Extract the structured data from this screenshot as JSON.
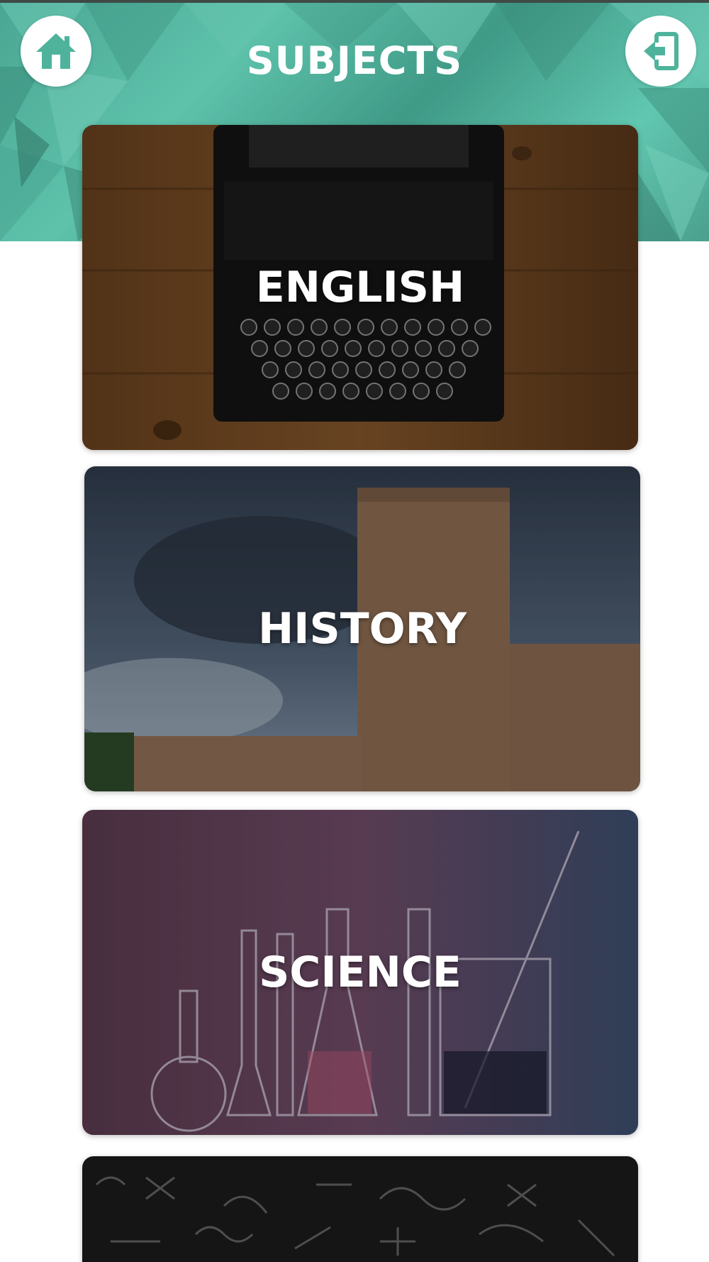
{
  "header": {
    "title": "SUBJECTS",
    "home_icon": "home-icon",
    "logout_icon": "logout-icon",
    "accent_color": "#4fb39c"
  },
  "subjects": [
    {
      "label": "ENGLISH",
      "image": "typewriter-image"
    },
    {
      "label": "HISTORY",
      "image": "castle-image"
    },
    {
      "label": "SCIENCE",
      "image": "lab-glassware-image"
    },
    {
      "label": "",
      "image": "chalkboard-image"
    }
  ]
}
